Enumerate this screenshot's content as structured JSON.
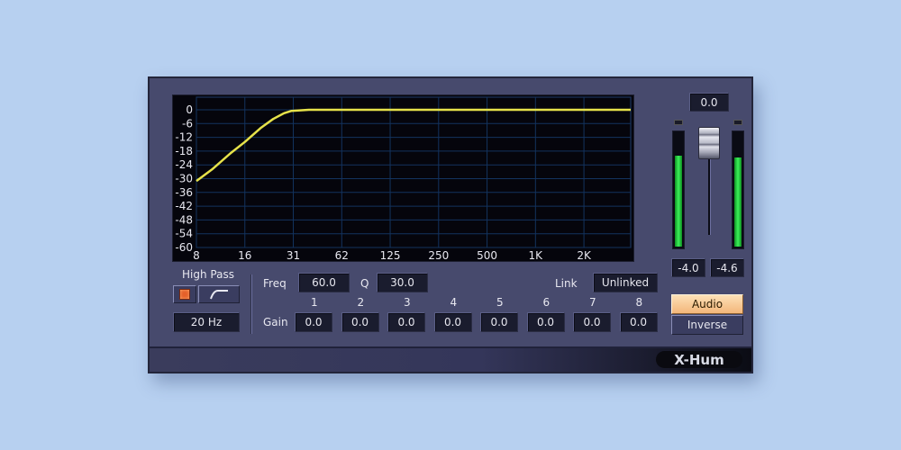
{
  "colors": {
    "background": "#b7d0f0",
    "panel": "#474a6d",
    "curve": "#e6e24a",
    "meter": "#3cf05a",
    "accent_button": "#f3b77a"
  },
  "graph": {
    "y_ticks": [
      "0",
      "-6",
      "-12",
      "-18",
      "-24",
      "-30",
      "-36",
      "-42",
      "-48",
      "-54",
      "-60"
    ],
    "x_ticks": [
      "8",
      "16",
      "31",
      "62",
      "125",
      "250",
      "500",
      "1K",
      "2K"
    ]
  },
  "chart_data": {
    "type": "line",
    "x_scale": "log",
    "xlim": [
      8,
      4000
    ],
    "ylim": [
      -60,
      0
    ],
    "series": [
      {
        "x": [
          8,
          10,
          13,
          16,
          20,
          24,
          28,
          31,
          40,
          62,
          125,
          250,
          500,
          1000,
          2000,
          4000
        ],
        "values": [
          -31,
          -26,
          -19,
          -14,
          -8,
          -4,
          -1.5,
          -0.5,
          0,
          0,
          0,
          0,
          0,
          0,
          0,
          0
        ]
      }
    ]
  },
  "high_pass": {
    "label": "High Pass",
    "freq": "20 Hz",
    "power_icon": "power-icon",
    "shape_icon": "highpass-shape-icon"
  },
  "freq": {
    "label": "Freq",
    "value": "60.0"
  },
  "q": {
    "label": "Q",
    "value": "30.0"
  },
  "link": {
    "label": "Link",
    "value": "Unlinked"
  },
  "gain": {
    "label": "Gain",
    "bands": [
      {
        "n": "1",
        "v": "0.0"
      },
      {
        "n": "2",
        "v": "0.0"
      },
      {
        "n": "3",
        "v": "0.0"
      },
      {
        "n": "4",
        "v": "0.0"
      },
      {
        "n": "5",
        "v": "0.0"
      },
      {
        "n": "6",
        "v": "0.0"
      },
      {
        "n": "7",
        "v": "0.0"
      },
      {
        "n": "8",
        "v": "0.0"
      }
    ]
  },
  "output": {
    "fader_value": "0.0",
    "left_meter": "-4.0",
    "right_meter": "-4.6",
    "left_level": 0.78,
    "right_level": 0.76
  },
  "mode": {
    "audio": "Audio",
    "inverse": "Inverse"
  },
  "brand": "X-Hum"
}
